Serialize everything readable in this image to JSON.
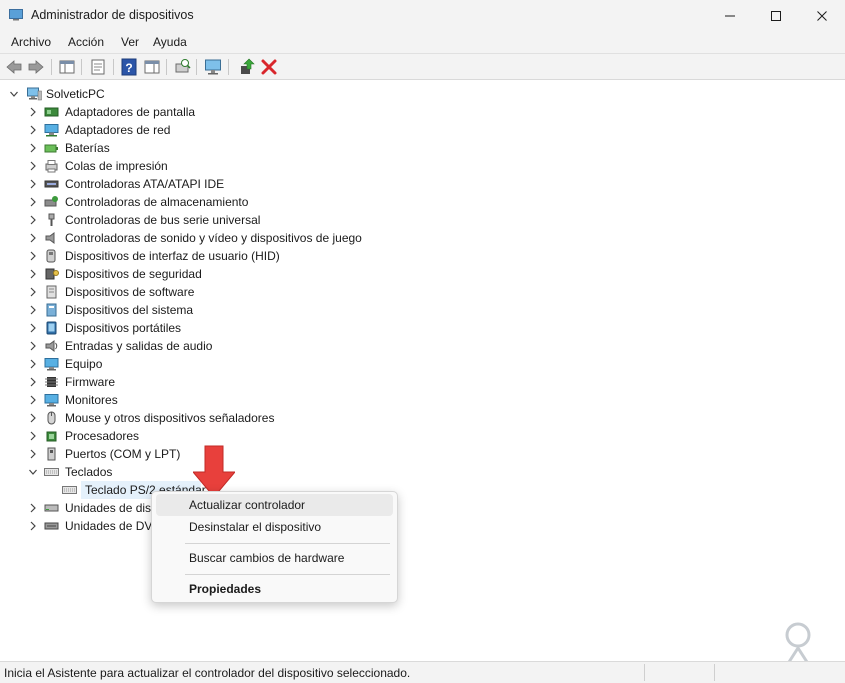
{
  "window": {
    "title": "Administrador de dispositivos",
    "minimize_icon": "minimize-icon",
    "maximize_icon": "maximize-icon",
    "close_icon": "close-icon"
  },
  "menu": [
    "Archivo",
    "Acción",
    "Ver",
    "Ayuda"
  ],
  "toolbar": {
    "buttons": [
      "back-arrow-icon",
      "forward-arrow-icon",
      "show-hide-console-tree-icon",
      "properties-icon",
      "help-icon",
      "action-pane-icon",
      "scan-hardware-icon",
      "computer-monitor-icon",
      "update-driver-icon",
      "uninstall-device-icon"
    ],
    "uninstall_color": "#d9262c"
  },
  "tree": {
    "root": "SolveticPC",
    "categories": [
      {
        "label": "Adaptadores de pantalla",
        "icon": "display-adapter-icon"
      },
      {
        "label": "Adaptadores de red",
        "icon": "network-adapter-icon"
      },
      {
        "label": "Baterías",
        "icon": "battery-icon"
      },
      {
        "label": "Colas de impresión",
        "icon": "print-queue-icon"
      },
      {
        "label": "Controladoras ATA/ATAPI IDE",
        "icon": "ide-controller-icon"
      },
      {
        "label": "Controladoras de almacenamiento",
        "icon": "storage-controller-icon"
      },
      {
        "label": "Controladoras de bus serie universal",
        "icon": "usb-icon"
      },
      {
        "label": "Controladoras de sonido y vídeo y dispositivos de juego",
        "icon": "speaker-icon"
      },
      {
        "label": "Dispositivos de interfaz de usuario (HID)",
        "icon": "hid-icon"
      },
      {
        "label": "Dispositivos de seguridad",
        "icon": "security-key-icon"
      },
      {
        "label": "Dispositivos de software",
        "icon": "software-device-icon"
      },
      {
        "label": "Dispositivos del sistema",
        "icon": "system-device-icon"
      },
      {
        "label": "Dispositivos portátiles",
        "icon": "portable-device-icon"
      },
      {
        "label": "Entradas y salidas de audio",
        "icon": "audio-io-icon"
      },
      {
        "label": "Equipo",
        "icon": "computer-icon"
      },
      {
        "label": "Firmware",
        "icon": "firmware-icon"
      },
      {
        "label": "Monitores",
        "icon": "monitor-icon"
      },
      {
        "label": "Mouse y otros dispositivos señaladores",
        "icon": "mouse-icon"
      },
      {
        "label": "Procesadores",
        "icon": "processor-icon"
      },
      {
        "label": "Puertos (COM y LPT)",
        "icon": "port-icon"
      },
      {
        "label": "Teclados",
        "icon": "keyboard-icon",
        "expanded": true
      },
      {
        "label": "Unidades de disc",
        "icon": "disk-drive-icon"
      },
      {
        "label": "Unidades de DVI",
        "icon": "dvd-drive-icon"
      }
    ],
    "child": {
      "label": "Teclado PS/2 estándar",
      "icon": "keyboard-icon",
      "selected": true
    }
  },
  "context_menu": {
    "items": [
      "Actualizar controlador",
      "Desinstalar el dispositivo",
      "Buscar cambios de hardware",
      "Propiedades"
    ],
    "highlighted_index": 0,
    "bold_index": 3
  },
  "annotation_arrow_color": "#e8403c",
  "status": {
    "text": "Inicia el Asistente para actualizar el controlador del dispositivo seleccionado."
  }
}
